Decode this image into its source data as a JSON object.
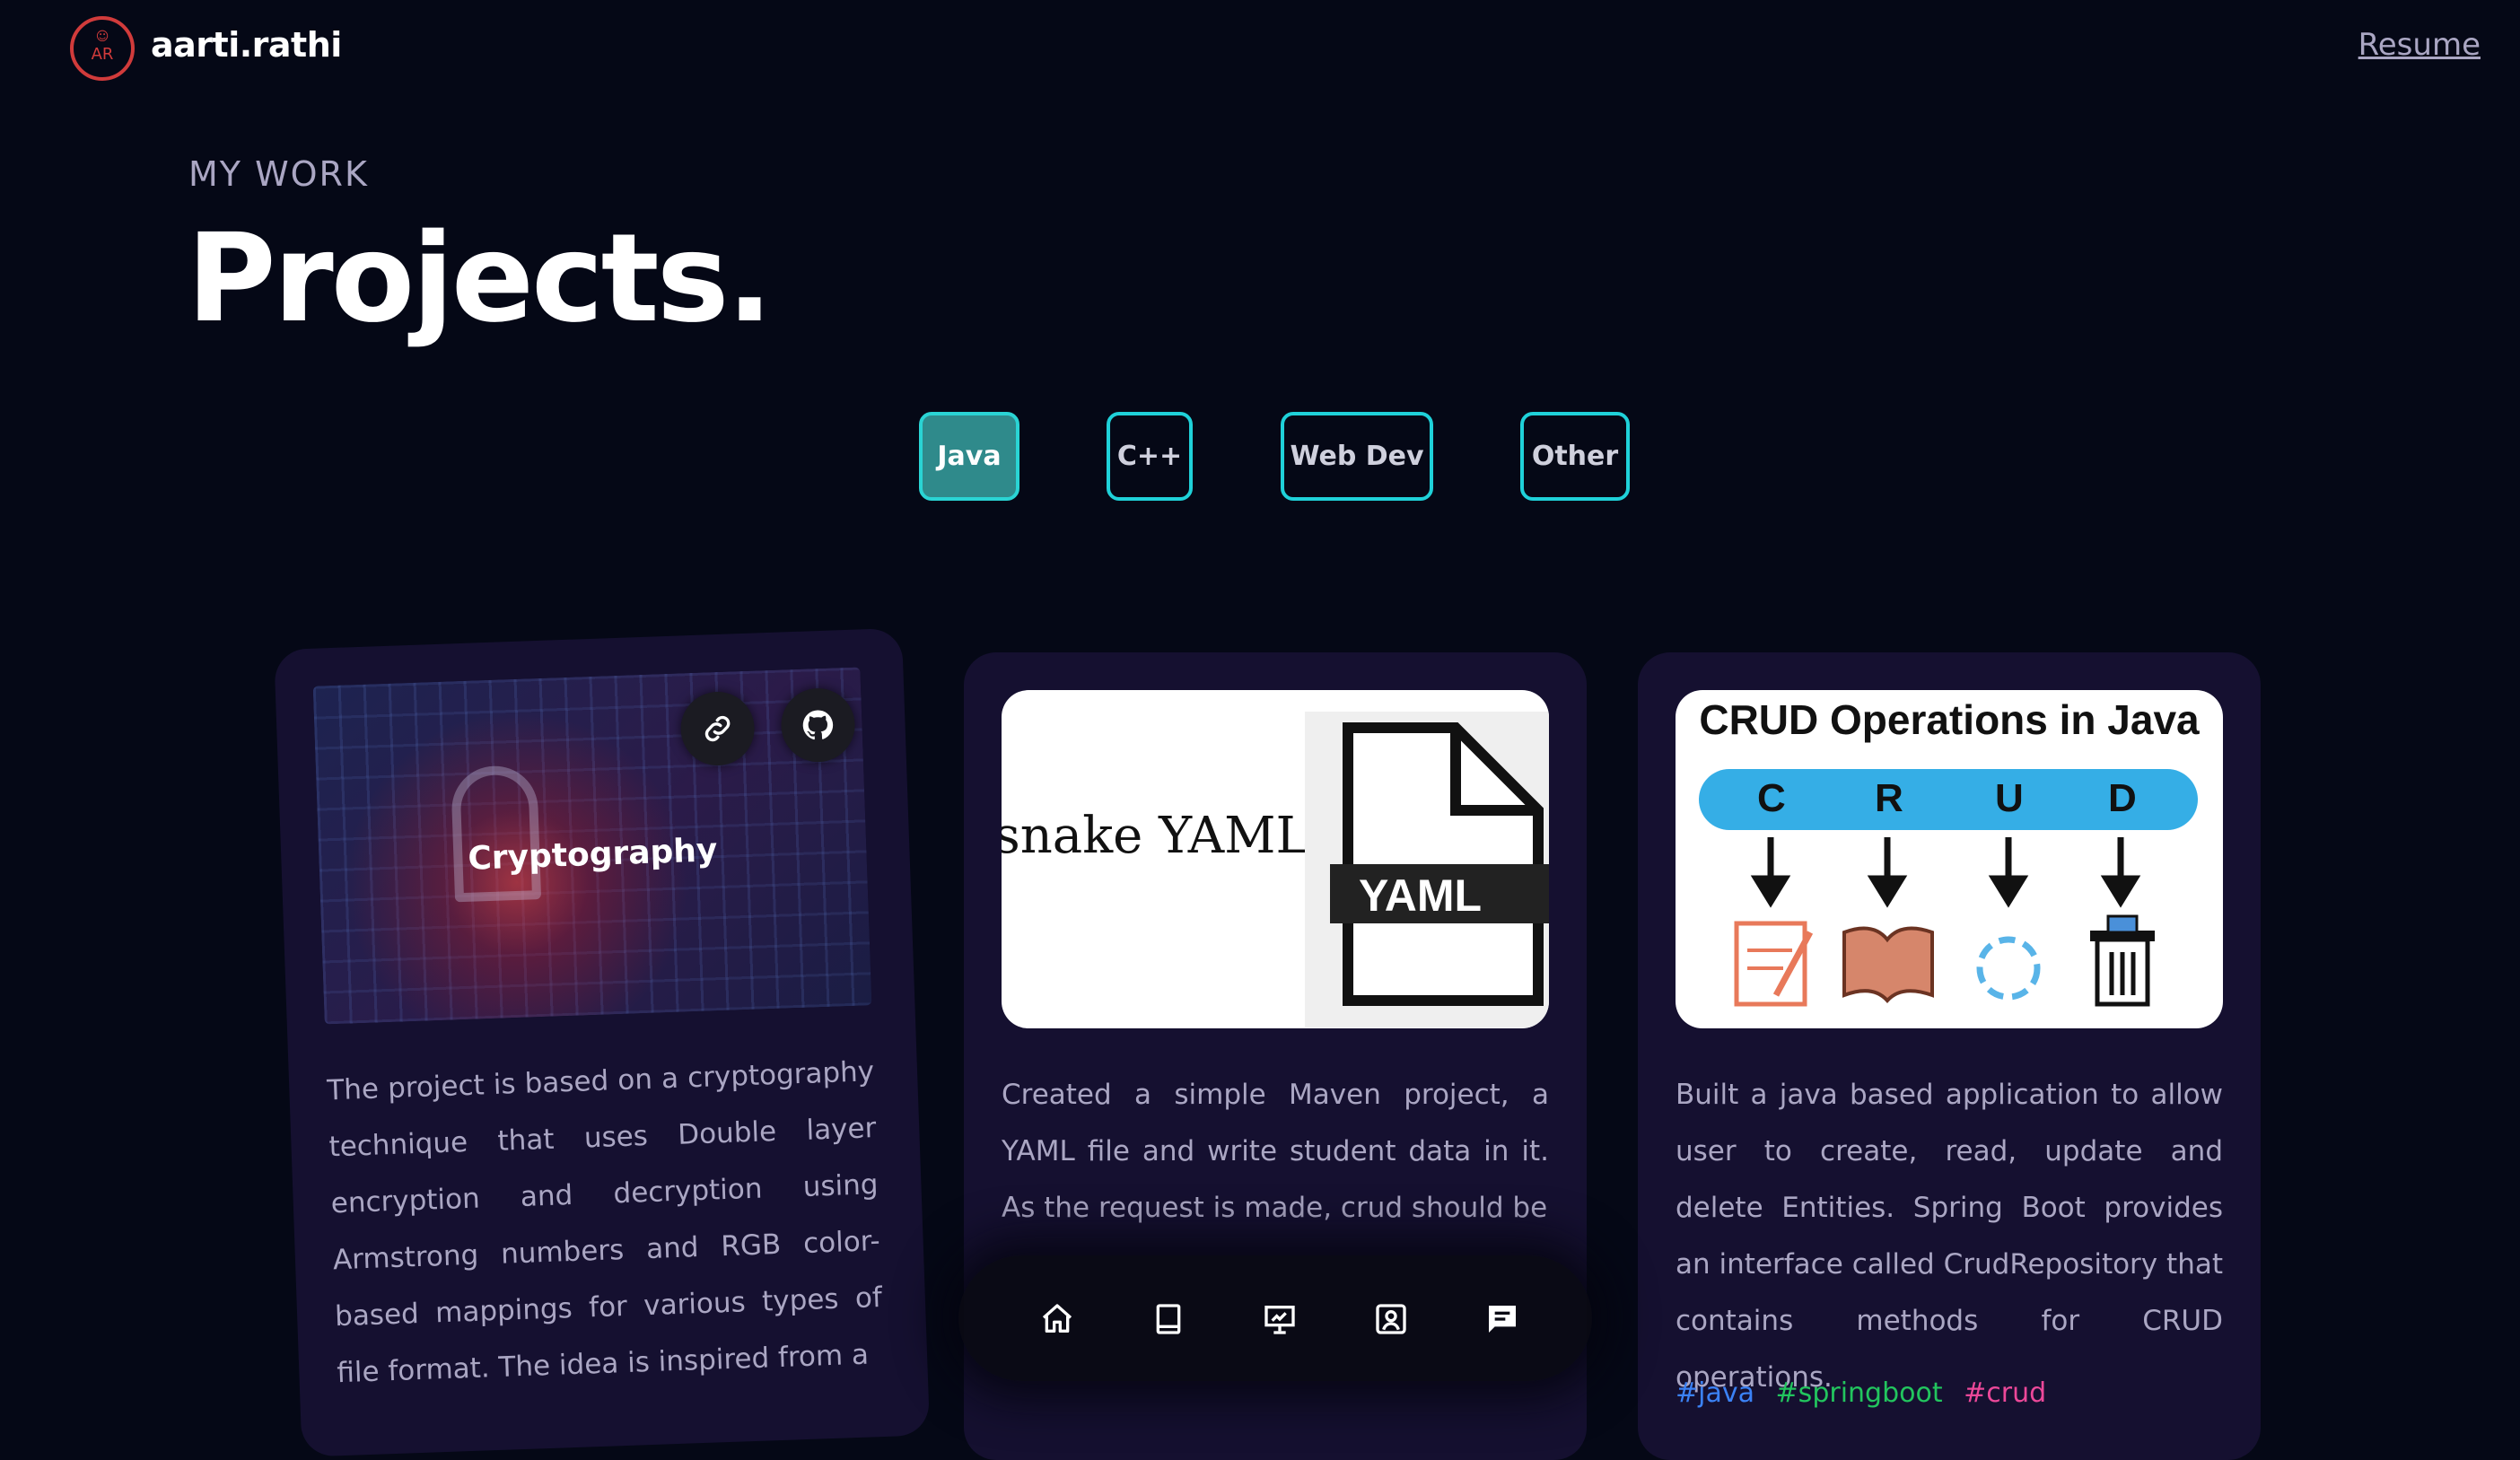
{
  "nav": {
    "logo_initials": "AR",
    "brand": "aarti.rathi",
    "resume_label": "Resume"
  },
  "header": {
    "subtitle": "MY WORK",
    "title": "Projects."
  },
  "filters": {
    "items": [
      "Java",
      "C++",
      "Web Dev",
      "Other"
    ],
    "active": "Java"
  },
  "projects": [
    {
      "image_title": "Cryptography",
      "description": "The project is based on a cryptography technique that uses Double layer encryption and decryption using Armstrong numbers and RGB color-based mappings for various types of file format. The idea is inspired from a",
      "icons": [
        "link-icon",
        "github-icon"
      ]
    },
    {
      "image_text": "snake YAML",
      "image_badge": "YAML",
      "description": "Created a simple Maven project, a YAML file and write student data in it. As the request is made, crud should be"
    },
    {
      "image_title": "CRUD Operations in Java",
      "image_letters": [
        "C",
        "R",
        "U",
        "D"
      ],
      "description": "Built a java based application to allow user to create, read, update and delete Entities. Spring Boot provides an interface called CrudRepository that contains methods for CRUD operations.",
      "tags": [
        "#java",
        "#springboot",
        "#crud"
      ]
    }
  ],
  "colors": {
    "background": "#050816",
    "card": "#151030",
    "accent": "#1fd1d9",
    "active_tab": "#2f8a8b",
    "secondary_text": "#aaa6c3",
    "tag_blue": "#3b82f6",
    "tag_green": "#22c55e",
    "tag_pink": "#ec4899"
  },
  "dock": [
    "home-icon",
    "book-icon",
    "presentation-icon",
    "contact-card-icon",
    "chat-icon"
  ]
}
